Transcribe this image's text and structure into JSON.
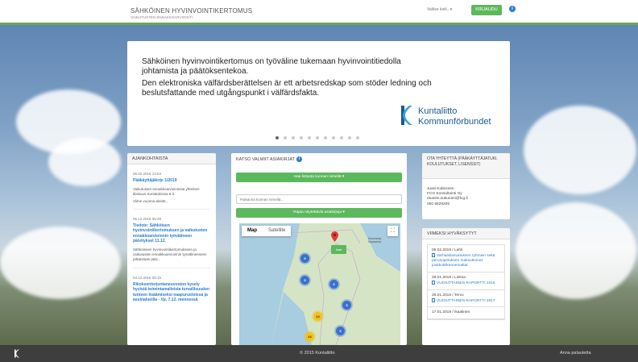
{
  "header": {
    "title": "SÄHKÖINEN HYVINVOINTIKERTOMUS",
    "subtitle": "VAIKUTUSTEN ENNAKKOARVIOINTI",
    "language_select": "Valitse kieli.. ▾",
    "login_label": "KIRJAUDU",
    "info_icon": "i"
  },
  "carousel": {
    "text_fi": "Sähköinen hyvinvointikertomus on työväline tukemaan hyvinvointitiedolla johtamista ja päätöksentekoa.",
    "text_sv": "Den elektroniska välfärdsberättelsen är ett arbetsredskap som stöder ledning och beslutsfattande med utgångspunkt i välfärdsfakta.",
    "logo_line1": "Kuntaliitto",
    "logo_line2": "Kommunförbundet",
    "active_slide": 1,
    "slide_count": 11
  },
  "news": {
    "heading": "AJANKOHTAISTA",
    "items": [
      {
        "date": "06.02.2019 13:54",
        "title": "Pääkäyttäjäkirje 1/2019",
        "body": "Vaikutusten ennakkoarvioinnista yhteinen tilaisuus Kuntatalossa 6.3.",
        "more": "Viime vuonna aloitet..."
      },
      {
        "date": "05.12.2018 08:29",
        "title": "Tiedote: Sähköisen hyvinvointikertomuksen ja vaikutusten ennakkoarvioinnin työvälineen päivitykset 11.12.",
        "body": "Sähköiseen hyvinvointikertomukseen ja vaikutusten ennakkoarvioinnin työvälineeseen julkaistaan päiv..."
      },
      {
        "date": "03.12.2018 09:15",
        "title": "Rikoksentorjuntaneuvoston kysely hyvistä toimintamalleista turvallisuuden tunteen lisäämiseksi naapurustoissa ja asuinalueilla - Vp. 7.12. mennessä"
      }
    ]
  },
  "reports": {
    "heading": "KATSO VALMIIT ASIAKIRJAT",
    "search_by_name_button": "Hae listasta kunnan nimellä ▾",
    "search_placeholder": "Paikanna kunnan nimellä...",
    "filter_button": "Rajaa näytettäviä asiakirjoja ▾",
    "map": {
      "tab_map": "Map",
      "tab_satellite": "Satellite",
      "fullscreen_icon": "⛶",
      "city_label": "Murmansk\nМурманск",
      "marker_label": "Inari",
      "clusters": [
        {
          "label": "5",
          "color": "blue"
        },
        {
          "label": "5",
          "color": "blue"
        },
        {
          "label": "5",
          "color": "blue"
        },
        {
          "label": "5",
          "color": "blue"
        },
        {
          "label": "5",
          "color": "blue"
        },
        {
          "label": "14",
          "color": "yellow"
        },
        {
          "label": "24",
          "color": "yellow"
        }
      ]
    }
  },
  "contact": {
    "heading": "OTA YHTEYTTÄ (PÄÄKÄYTTÄJATUKI, KOULUTUKSET, LISENSSIT)",
    "name": "Jussi Kukkonen",
    "company": "FCG Konsultointi Oy",
    "email": "etunimi.sukunimi@fcg.fi",
    "phone": "050 5629205"
  },
  "approved": {
    "heading": "VIIMEKSI HYVÄKSYTYT",
    "items": [
      {
        "date": "06.02.2019 / Lahti",
        "link": "Varhaiskasvatuksen ryhmien sekä perusopetuksen maksuttomat joukkokilkennemaltat"
      },
      {
        "date": "28.01.2019 / Lieksa",
        "link": "VUOSITTAINEN RAPORTTI 2018"
      },
      {
        "date": "28.01.2019 / Tervo",
        "link": "VUOSITTAINEN RAPORTTI 2017"
      },
      {
        "date": "17.01.2019 / Ikaalinen",
        "link": ""
      }
    ]
  },
  "footer": {
    "copyright": "© 2015 Kuntaliitto",
    "feedback": "Anna palautetta"
  },
  "colors": {
    "accent_green": "#5cb85c",
    "link_blue": "#2a7bd1",
    "brand_blue": "#1a5a8c",
    "footer_bg": "#3e3e3e"
  }
}
